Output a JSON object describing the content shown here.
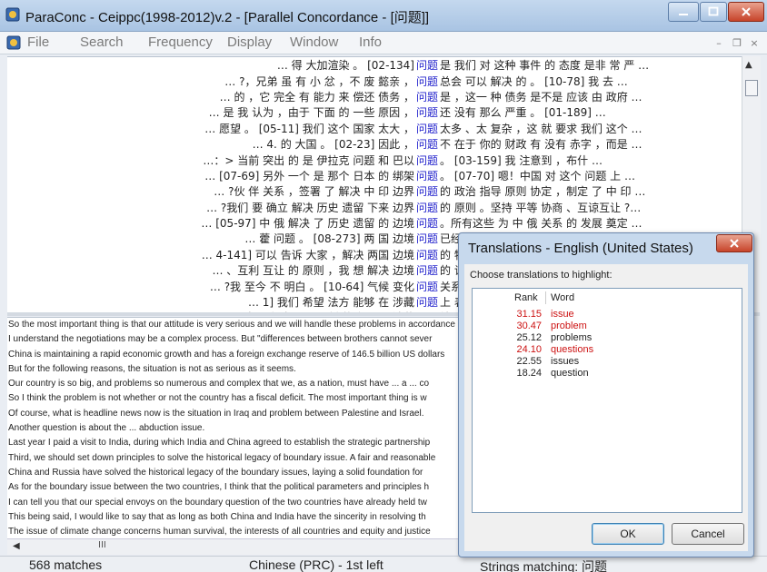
{
  "window": {
    "title": "ParaConc - Ceippc(1998-2012)v.2 - [Parallel Concordance - [问题]]"
  },
  "menu": {
    "items": [
      "File",
      "Search",
      "Frequency",
      "Display",
      "Window",
      "Info"
    ]
  },
  "concordance": [
    {
      "left": "… 得 大加渲染 。   [02-134]",
      "node": "问题",
      "right": "是 我们 对 这种 事件 的 态度 是非 常 严 …",
      "right_red": "我们"
    },
    {
      "left": "… ?，兄弟 虽 有 小 忿 ，不 废 懿亲 ，",
      "node": "问题",
      "right": "总会 可以 解决 的 。 [10-78] 我 去 …"
    },
    {
      "left": "… 的 ，它 完全 有 能力 来 偿还 债务 ，",
      "node": "问题",
      "right": "是 ，这一 种 债务 是不是 应该 由 政府 …",
      "right_red": "是"
    },
    {
      "left": "… 是 我 认为 ，由于 下面 的 一些 原因 ，",
      "node": "问题",
      "right": "还 没有 那么 严重 。 [01-189]  …",
      "right_red": "没有"
    },
    {
      "left": "… 愿望 。 [05-11] 我们 这个 国家 太大 ，",
      "node": "问题",
      "right": "太多 、太 复杂 ，这 就 要求 我们 这个 …"
    },
    {
      "left": "… 4. 的 大国 。 [02-23] 因此 ，",
      "node": "问题",
      "right": "不 在于 你的 财政 有 没有 赤字 ，而是 …"
    },
    {
      "left": "…：> 当前 突出 的 是 伊拉克 问题 和 巴以",
      "node": "问题",
      "right": "。 [03-159] 我 注意到 ，布什 …"
    },
    {
      "left": "… [07-69] 另外 一个 是 那个 日本 的 绑架",
      "node": "问题",
      "right": "。 [07-70] 嗯！中国 对 这个 问题 上 …",
      "right_red": "。"
    },
    {
      "left": "… ?伙 伴 关系 ，签署 了 解决 中 印 边界",
      "node": "问题",
      "right": "的 政治 指导 原则 协定 ，制定 了 中 印 …"
    },
    {
      "left": "… ?我们 要 确立 解决 历史 遗留 下来 边界",
      "node": "问题",
      "right": "的 原则 。坚持 平等 协商 、互谅互让 ?…"
    },
    {
      "left": "… [05-97] 中 俄 解决 了 历史 遗留 的 边境",
      "node": "问题",
      "right": "。所有这些 为 中 俄 关系 的 发展 奠定 …"
    },
    {
      "left": "… 藿 问题 。 [08-273] 两 国 边境",
      "node": "问题",
      "right": "已经 确立 了 解决 的 政治 指导 原则 ，"
    },
    {
      "left": "… 4-141] 可以 告诉 大家 ，解决 两国 边境",
      "node": "问题",
      "right": "的 特使 已经 …"
    },
    {
      "left": "… 、互利 互让 的 原则 ，我 想 解决 边境",
      "node": "问题",
      "right": "的 谈判 会 有 …"
    },
    {
      "left": "… ?我 至今 不 明白 。 [10-64] 气候 变化",
      "node": "问题",
      "right": "关系 到 人类 …"
    },
    {
      "left": "… 1] 我们 希望 法方 能够 在 涉藏",
      "node": "问题",
      "right": "上 表明 明确 …"
    },
    {
      "left": "… 是 中国 领土 不可分割 的 部分 ，涉藏",
      "node": "问题",
      "right": "纯属 中国 的 …"
    },
    {
      "left": "… ?需 要 好 地 解决 香港 的 一些 深 层次",
      "node": "问题",
      "right": "。可 不 说 明 …"
    }
  ],
  "translations": [
    "So the most important thing is that our attitude is very serious and we will handle these problems in accordance",
    "I understand the negotiations may be a complex process. But \"differences between brothers cannot sever",
    "China is maintaining a rapid economic growth and has a foreign exchange reserve of 146.5 billion US dollars",
    "But for the following reasons, the situation is not as serious as it seems.",
    "Our country is so big, and problems so numerous and complex that we, as a nation, must have ... a ... co",
    "So I think the problem is not whether or not the country has a fiscal deficit. The most important thing is w",
    "Of course, what is headline news now is the situation in Iraq and problem between Palestine and Israel.",
    "Another question is about the ... abduction issue.",
    "Last year I paid a visit to India, during which India and China agreed to establish the strategic partnership",
    "Third, we should set down principles to solve the historical legacy of boundary issue. A fair and reasonable",
    "China and Russia have solved the historical legacy of the boundary issues, laying a solid foundation for",
    "As for the boundary issue between the two countries, I think that the political parameters and principles h",
    "I can tell you that our special envoys on the boundary question of the two countries have already held tw",
    "This being said, I would like to say that as long as both China and India have the sincerity in resolving th",
    "The issue of climate change concerns human survival, the interests of all countries and equity and justice"
  ],
  "scroll_grip": "III",
  "status": {
    "matches": "568 matches",
    "language": "Chinese (PRC) - 1st left",
    "strings": "Strings matching: 问题"
  },
  "dialog": {
    "title": "Translations - English (United States)",
    "prompt": "Choose translations to highlight:",
    "col_rank": "Rank",
    "col_word": "Word",
    "rows": [
      {
        "rank": "31.15",
        "word": "issue",
        "highlight": true
      },
      {
        "rank": "30.47",
        "word": "problem",
        "highlight": true
      },
      {
        "rank": "25.12",
        "word": "problems",
        "highlight": false
      },
      {
        "rank": "24.10",
        "word": "questions",
        "highlight": true
      },
      {
        "rank": "22.55",
        "word": "issues",
        "highlight": false
      },
      {
        "rank": "18.24",
        "word": "question",
        "highlight": false
      }
    ],
    "ok": "OK",
    "cancel": "Cancel"
  },
  "colors": {
    "highlight": "#cc1111",
    "node": "#2222cc"
  }
}
